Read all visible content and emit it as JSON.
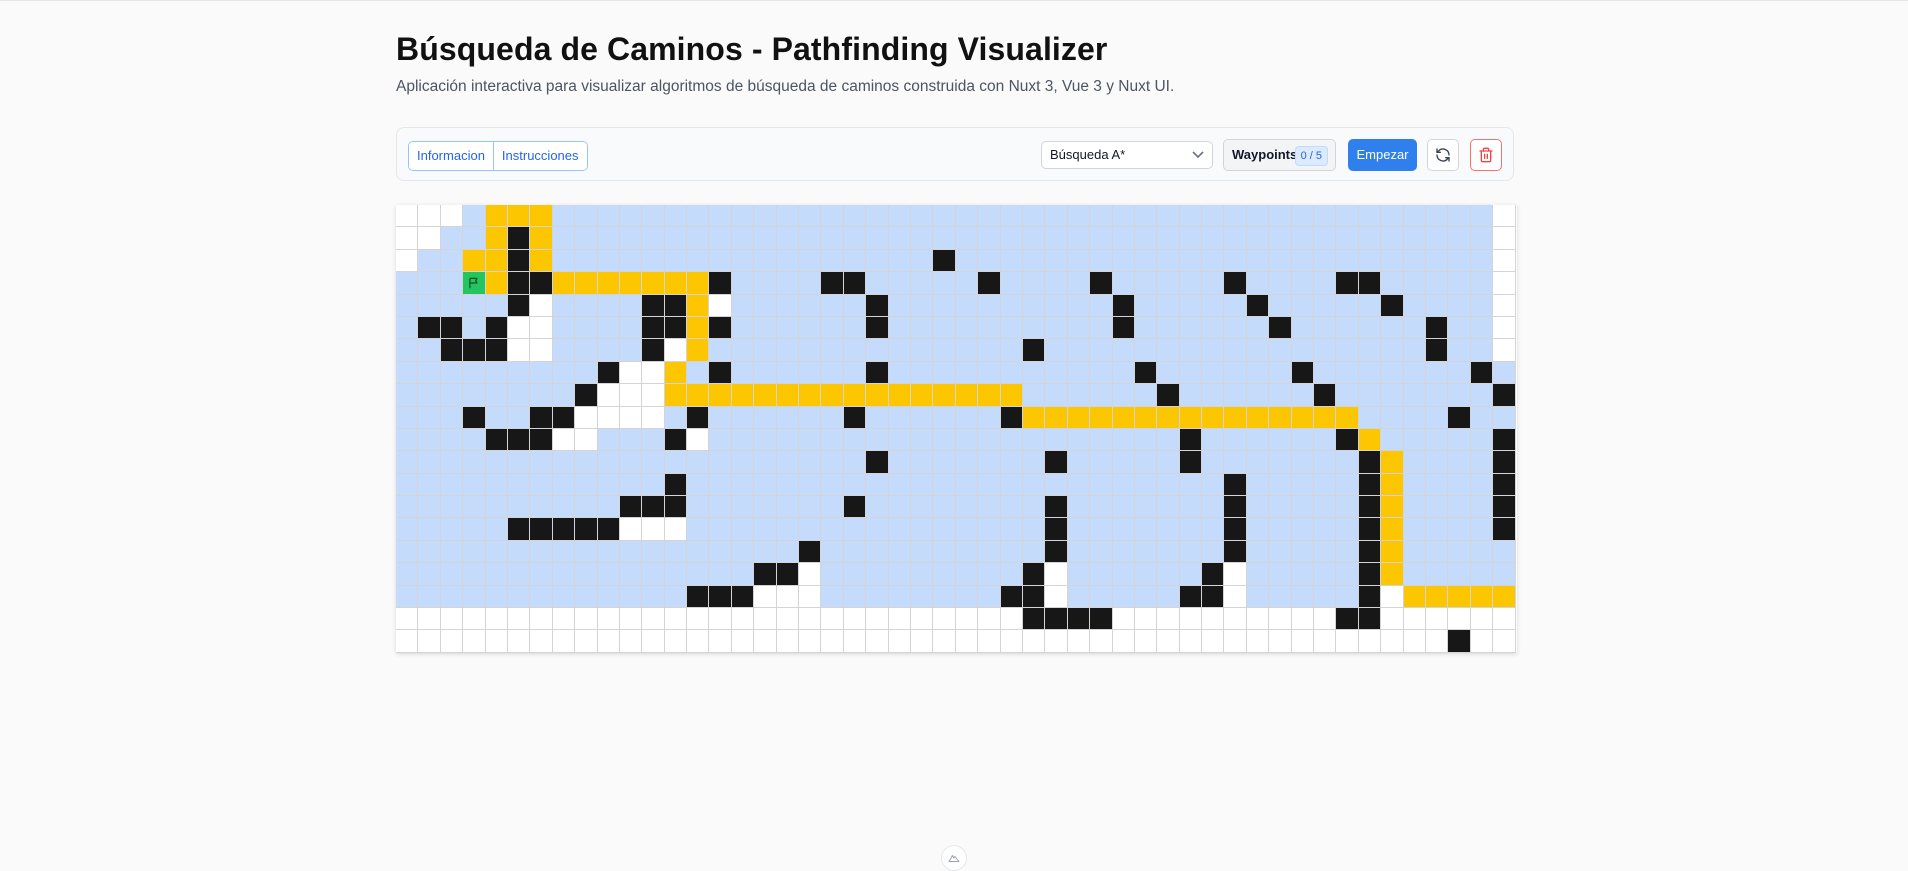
{
  "header": {
    "title": "Búsqueda de Caminos - Pathfinding Visualizer",
    "subtitle": "Aplicación interactiva para visualizar algoritmos de búsqueda de caminos construida con Nuxt 3, Vue 3 y Nuxt UI."
  },
  "toolbar": {
    "tabs": [
      {
        "label": "Informacion"
      },
      {
        "label": "Instrucciones"
      }
    ],
    "algorithm_select": {
      "value": "Búsqueda A*"
    },
    "waypoints": {
      "label": "Waypoints",
      "count": "0 / 5"
    },
    "start_label": "Empezar",
    "refresh_icon": "refresh-icon",
    "delete_icon": "trash-icon"
  },
  "grid": {
    "cols": 50,
    "rows": 20,
    "legend": {
      ".": "empty",
      "v": "visited",
      "p": "path",
      "#": "wall",
      "S": "start",
      "E": "end"
    },
    "cells": [
      "...vpppvvvvvvvvvvvvvvvvvvvvvvvvvvvvvvvvvvvvvvvvvv.",
      "..vvp#pvvvvvvvvvvvvvvvvvvvvvvvvvvvvvvvvvvvvvvvvvv.",
      ".vvpp#pvvvvvvvvvvvvvvvvv#vvvvvvvvvvvvvvvvvvvvvvvv.",
      "vvvSp##ppppppp#vvvv##vvvvv#vvvv#vvvvv#vvvv##vvvvv.",
      "vvvvv#.vvvv##p.vvvvvv#vvvvvvvvvv#vvvvv#vvvvv#vvvv.",
      "v##v#..vvvv##p#vvvvvv#vvvvvvvvvv#vvvvvv#vvvvvv#vv.",
      "vv###..vvvv#.pvvvvvvvvvvvvvv#vvvvvvvvvvvvvvvvv#vv.",
      "vvvvvvvvv#..pv#vvvvvv#vvvvvvvvvvv#vvvvvv#vvvvvvv#v.",
      "vvvvvvvv#...ppppppppppppppppvvvvvv#vvvvvv#vvvvvvv#v.",
      "vvv#vv##....v#vvvvvv#vvvvvv#pppppppppppppppvvvv#vv.",
      "vvvv###..vvv#.vvvvvvvvvvvvvvvvvvvvv#vvvvvv#pvvvvv#v.",
      "vvvvvvvvvvvvvvvvvvvvv#vvvvvvv#vvvvv#vvvvvvv#pvvvv#v.",
      "vvvvvvvvvvvv#vvvvvvvvvvvvvvvvvvvvvvvv#vvvvv#pvvvv#v.",
      "vvvvvvvvvv###vvvvvvv#vvvvvvvv#vvvvvvv#vvvvv#pvvvv#v.",
      "vvvvv#####...vvvvvvvvvvvvvvvv#vvvvvvv#vvvvv#pvvvv#v.",
      "vvvvvvvvvvvvvvvvvv#vvvvvvvvvv#vvvvvvv#vvvvv#pvvvvvv.",
      "vvvvvvvvvvvvvvvv##.vvvvvvvvv#.vvvvvv#.vvvvv#pvvvvvv.",
      "vvvvvvvvvvvvv###...vvvvvvvv##.vvvvv##.vvvvv#.pppppE.",
      "............................####..........##........#..........",
      "...............................................#........#.......",
      ".........................................................................."
    ]
  }
}
